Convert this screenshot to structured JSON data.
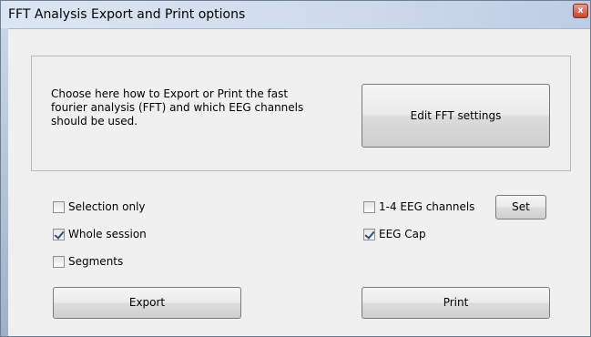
{
  "window": {
    "title": "FFT Analysis Export and Print options",
    "close_glyph": "x"
  },
  "description": "Choose here how to Export or Print the fast\nfourier analysis (FFT) and which EEG channels\nshould be used.",
  "buttons": {
    "edit_fft": "Edit FFT settings",
    "set": "Set",
    "export": "Export",
    "print": "Print"
  },
  "options_left": [
    {
      "label": "Selection only",
      "checked": false
    },
    {
      "label": "Whole session",
      "checked": true
    },
    {
      "label": "Segments",
      "checked": false
    }
  ],
  "options_right": [
    {
      "label": "1-4 EEG channels",
      "checked": false
    },
    {
      "label": "EEG Cap",
      "checked": true
    }
  ]
}
